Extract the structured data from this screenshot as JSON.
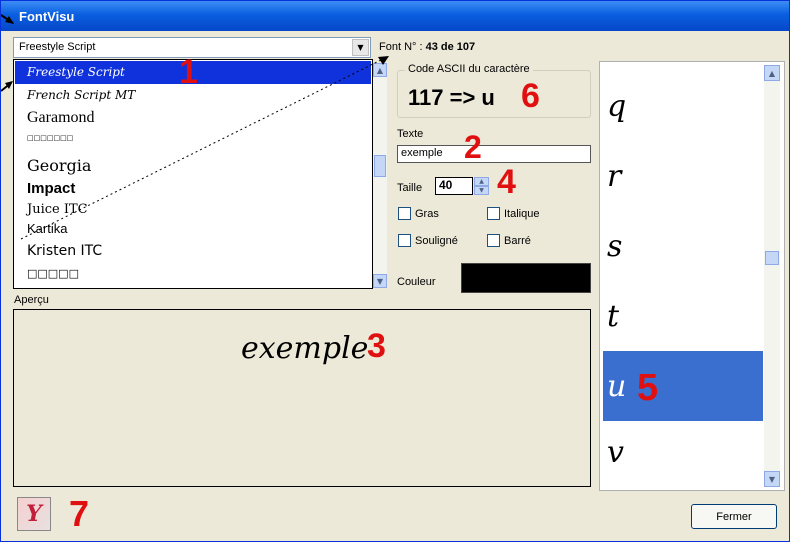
{
  "window": {
    "title": "FontVisu"
  },
  "font_combo": {
    "value": "Freestyle Script"
  },
  "font_number": {
    "label": "Font N° :",
    "value": "43 de 107"
  },
  "font_list": {
    "items": [
      {
        "label": "Freestyle Script",
        "selected": true
      },
      {
        "label": "French Script MT",
        "selected": false
      },
      {
        "label": "Garamond",
        "selected": false
      },
      {
        "label": "□□□□□□□",
        "selected": false
      },
      {
        "label": "Georgia",
        "selected": false
      },
      {
        "label": "Impact",
        "selected": false
      },
      {
        "label": "Juice ITC",
        "selected": false
      },
      {
        "label": "Kartika",
        "selected": false
      },
      {
        "label": "Kristen ITC",
        "selected": false
      },
      {
        "label": "□□□□□",
        "selected": false
      }
    ]
  },
  "ascii_group": {
    "label": "Code ASCII du caractère",
    "display": "117 => u"
  },
  "text_field": {
    "label": "Texte",
    "value": "exemple"
  },
  "size_field": {
    "label": "Taille",
    "value": "40"
  },
  "options": {
    "bold": {
      "label": "Gras",
      "checked": false
    },
    "italic": {
      "label": "Italique",
      "checked": false
    },
    "underline": {
      "label": "Souligné",
      "checked": false
    },
    "strike": {
      "label": "Barré",
      "checked": false
    }
  },
  "color": {
    "label": "Couleur",
    "value": "#000000"
  },
  "preview": {
    "label": "Aperçu",
    "text": "exemple"
  },
  "char_list": {
    "items": [
      {
        "char": "q",
        "selected": false
      },
      {
        "char": "r",
        "selected": false
      },
      {
        "char": "s",
        "selected": false
      },
      {
        "char": "t",
        "selected": false
      },
      {
        "char": "u",
        "selected": true
      },
      {
        "char": "v",
        "selected": false
      }
    ]
  },
  "buttons": {
    "close": "Fermer"
  },
  "app_icon": {
    "glyph": "Y"
  },
  "annotations": [
    "1",
    "2",
    "3",
    "4",
    "5",
    "6",
    "7"
  ],
  "colors": {
    "title_bar": "#0a5fe0",
    "selection": "#1032dc",
    "char_selection": "#3a6fd0",
    "annotation": "#e01010"
  }
}
